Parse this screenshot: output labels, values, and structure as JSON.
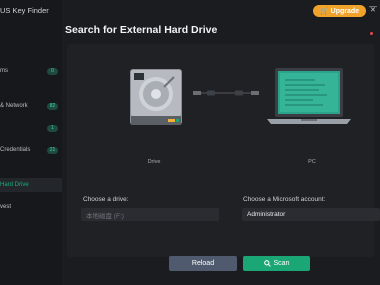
{
  "app": {
    "title": "US Key Finder"
  },
  "topbar": {
    "upgrade_label": "Upgrade",
    "upgrade_icon": "cart-icon",
    "minimize_glyph": "—",
    "close_glyph": "✕"
  },
  "sidebar": {
    "items": [
      {
        "label": "ms",
        "count": "0"
      },
      {
        "label": "& Network",
        "count": "82"
      },
      {
        "label": "",
        "count": "1"
      },
      {
        "label": "Credentials",
        "count": "21"
      },
      {
        "label": "Hard Drive",
        "count": ""
      },
      {
        "label": "vest",
        "count": ""
      }
    ],
    "accent": "#18b07c"
  },
  "main": {
    "title": "Search for External Hard Drive",
    "drive_caption": "Drive",
    "pc_caption": "PC",
    "drive_field": {
      "label": "Choose a drive:",
      "value": "本地磁盘 (F:)"
    },
    "account_field": {
      "label": "Choose a Microsoft account:",
      "value": "Administrator"
    },
    "reload_label": "Reload",
    "scan_label": "Scan",
    "scan_icon": "search-icon"
  },
  "colors": {
    "upgrade": "#f1a22a",
    "scan": "#1aa775",
    "reload": "#4f5a6f"
  }
}
